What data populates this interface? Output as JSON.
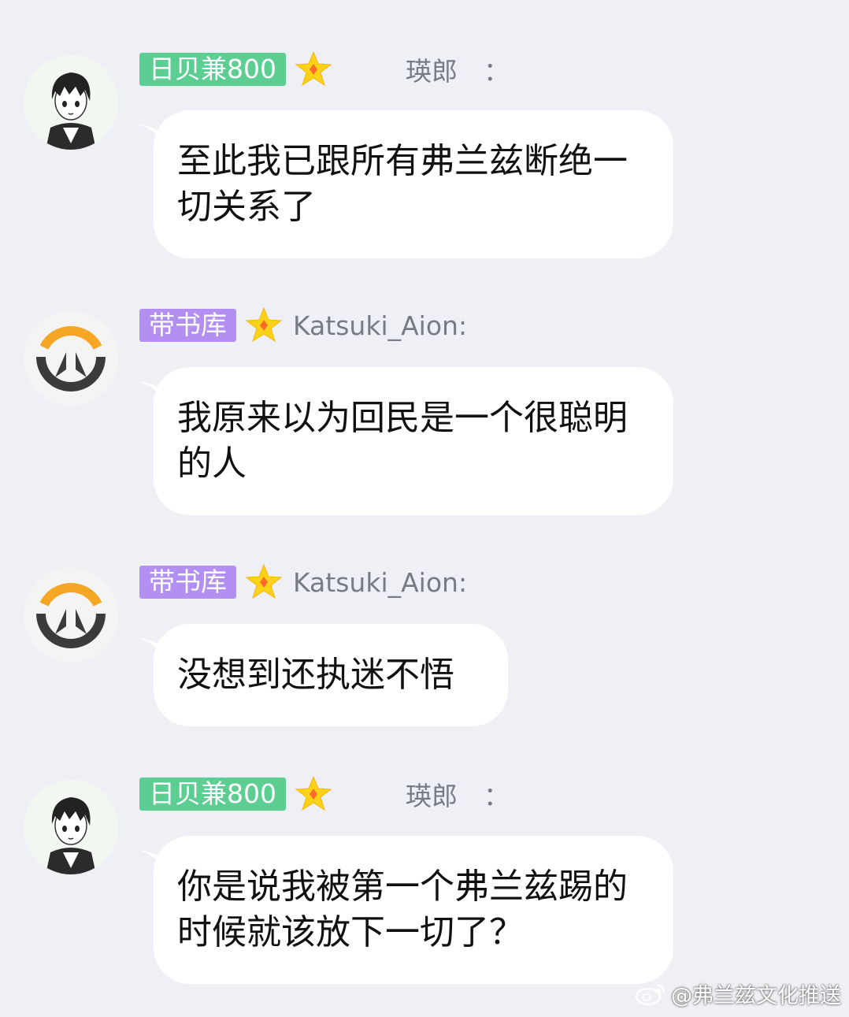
{
  "messages": [
    {
      "badge": "日贝兼800",
      "badge_color": "#5cce92",
      "username": "瑛郎　：",
      "avatar_icon": "anime-boy-avatar-icon",
      "text": "至此我已跟所有弗兰兹断绝一切关系了"
    },
    {
      "badge": "带书库",
      "badge_color": "#b28ff0",
      "username": "Katsuki_Aion:",
      "avatar_icon": "overwatch-logo-icon",
      "text": "我原来以为回民是一个很聪明的人"
    },
    {
      "badge": "带书库",
      "badge_color": "#b28ff0",
      "username": "Katsuki_Aion:",
      "avatar_icon": "overwatch-logo-icon",
      "text": "没想到还执迷不悟"
    },
    {
      "badge": "日贝兼800",
      "badge_color": "#5cce92",
      "username": "瑛郎　：",
      "avatar_icon": "anime-boy-avatar-icon",
      "text": "你是说我被第一个弗兰兹踢的时候就该放下一切了？"
    }
  ],
  "watermark": "@弗兰兹文化推送",
  "star_icon": "gold-star-icon"
}
